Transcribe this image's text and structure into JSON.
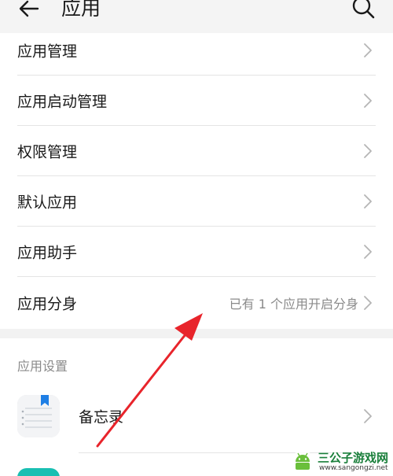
{
  "header": {
    "title": "应用",
    "back_icon": "arrow-left-icon",
    "search_icon": "search-icon"
  },
  "menu": {
    "items": [
      {
        "label": "应用管理",
        "value": ""
      },
      {
        "label": "应用启动管理",
        "value": ""
      },
      {
        "label": "权限管理",
        "value": ""
      },
      {
        "label": "默认应用",
        "value": ""
      },
      {
        "label": "应用助手",
        "value": ""
      },
      {
        "label": "应用分身",
        "value": "已有 1 个应用开启分身"
      }
    ]
  },
  "settings": {
    "header": "应用设置",
    "apps": [
      {
        "label": "备忘录",
        "icon": "notepad-icon"
      }
    ]
  },
  "annotation": {
    "arrow_color": "#e8242b"
  },
  "watermark": {
    "name": "三公子游戏网",
    "url": "www.sangongzi.net"
  },
  "colors": {
    "background": "#f2f2f2",
    "card": "#ffffff",
    "secondary_text": "#8a8a8a",
    "accent_blue": "#1f7fe5",
    "next_app_teal": "#19bfb2"
  }
}
